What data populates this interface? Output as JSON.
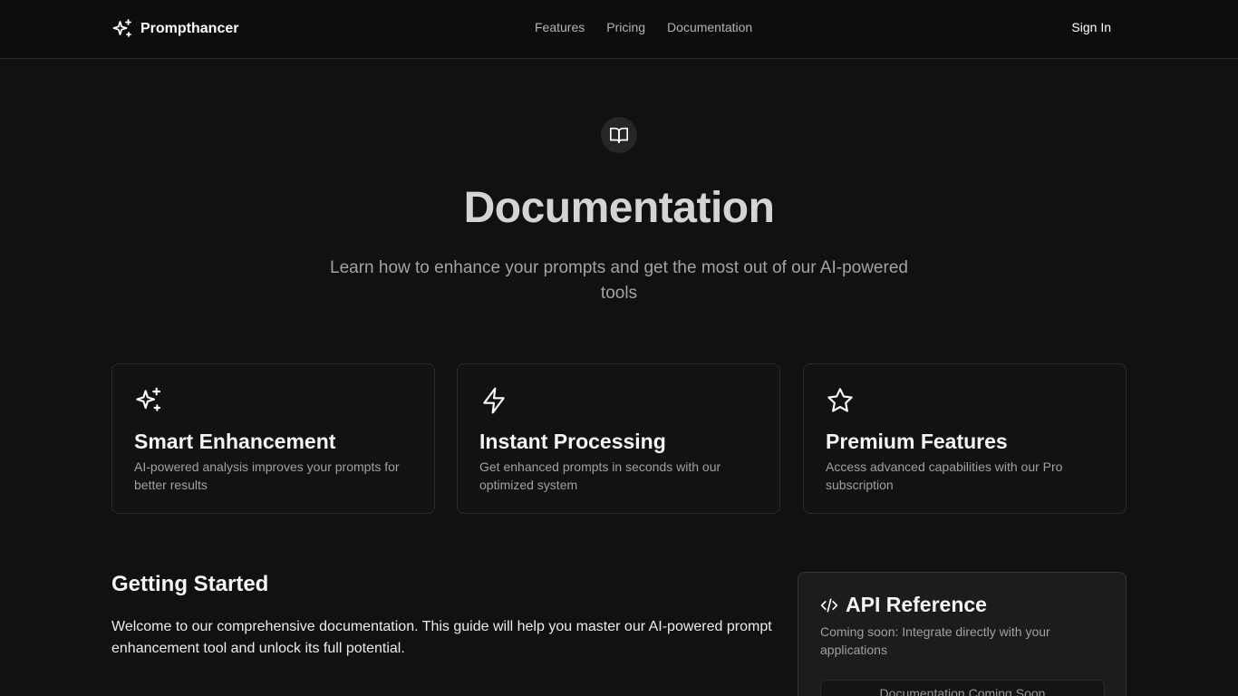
{
  "header": {
    "brand": "Prompthancer",
    "nav": [
      "Features",
      "Pricing",
      "Documentation"
    ],
    "sign_in": "Sign In"
  },
  "hero": {
    "icon": "book-open-icon",
    "title": "Documentation",
    "subtitle": "Learn how to enhance your prompts and get the most out of our AI-powered tools"
  },
  "features": [
    {
      "icon": "sparkles-icon",
      "title": "Smart Enhancement",
      "description": "AI-powered analysis improves your prompts for better results"
    },
    {
      "icon": "zap-icon",
      "title": "Instant Processing",
      "description": "Get enhanced prompts in seconds with our optimized system"
    },
    {
      "icon": "star-icon",
      "title": "Premium Features",
      "description": "Access advanced capabilities with our Pro subscription"
    }
  ],
  "getting_started": {
    "title": "Getting Started",
    "text": "Welcome to our comprehensive documentation. This guide will help you master our AI-powered prompt enhancement tool and unlock its full potential."
  },
  "api_reference": {
    "icon": "code-icon",
    "title": "API Reference",
    "description": "Coming soon: Integrate directly with your applications",
    "button": "Documentation Coming Soon"
  },
  "colors": {
    "background": "#111111",
    "header": "#0d0d0d",
    "card_border": "#2b2b2b",
    "muted_text": "#a0a0a0"
  }
}
